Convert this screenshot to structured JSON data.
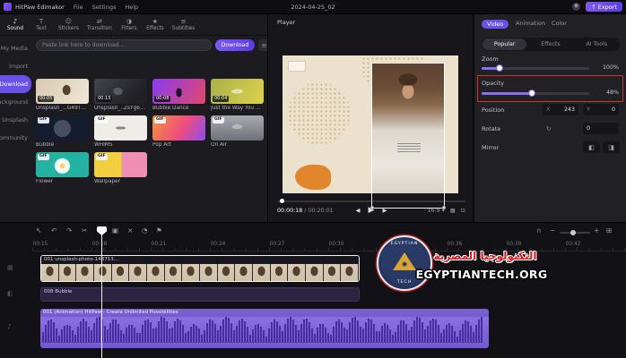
{
  "titlebar": {
    "app_name": "HitPaw Edimakor",
    "menus": [
      "File",
      "Settings",
      "Help"
    ],
    "project_name": "2024-04-25_02",
    "export_label": "Export"
  },
  "asset_tabs": [
    "Sound",
    "Text",
    "Stickers",
    "Transition",
    "Filters",
    "Effects",
    "Subtitles"
  ],
  "sidebar": {
    "items": [
      "My Media",
      "Import",
      "Download",
      "Background",
      "Unsplash",
      "Community"
    ]
  },
  "download_bar": {
    "placeholder": "Paste link here to download...",
    "button_label": "Download"
  },
  "media": {
    "items": [
      {
        "name": "Unsplash_...G49Tg6r",
        "duration": "00:05"
      },
      {
        "name": "Unsplash_..ZsYg6BU",
        "duration": "00:13"
      },
      {
        "name": "Bubble Dance",
        "duration": "00:08"
      },
      {
        "name": "Just the Way You Are",
        "duration": "00:04"
      },
      {
        "name": "Bubble",
        "badge": "GIF"
      },
      {
        "name": "WHIMS",
        "badge": "GIF"
      },
      {
        "name": "Pop Art",
        "badge": "GIF"
      },
      {
        "name": "On Air",
        "badge": "GIF"
      },
      {
        "name": "Flower",
        "badge": "GIF"
      },
      {
        "name": "Wallpaper",
        "badge": "GIF"
      }
    ]
  },
  "player": {
    "title": "Player",
    "current_time": "00:00:18",
    "total_time": " / 00:20:01",
    "ratio": "16:9"
  },
  "properties": {
    "tabs": [
      "Video",
      "Animation",
      "Color"
    ],
    "subtabs": [
      "Popular",
      "Effects",
      "AI Tools"
    ],
    "zoom_label": "Zoom",
    "zoom_value": "100%",
    "opacity_label": "Opacity",
    "opacity_value": "48%",
    "position_label": "Position",
    "x_label": "X",
    "x_value": "243",
    "y_label": "Y",
    "y_value": "0",
    "rotate_label": "Rotate",
    "rotate_value": "0",
    "mirror_label": "Mirror"
  },
  "timeline": {
    "ruler": [
      "00:15",
      "00:18",
      "00:21",
      "00:24",
      "00:27",
      "00:30",
      "00:33",
      "00:36",
      "00:39",
      "00:42"
    ],
    "clips": {
      "video_label": "001 unsplash-photo-148713...",
      "overlay_label": "008 Bubble",
      "audio_label": "001 (Animation) HitPaw - Create Unlimited Possibilities"
    }
  },
  "watermark": {
    "logo_line1": "EGYPTIAN",
    "logo_line2": "TECH",
    "arabic": "التكنولوجيا المصرية",
    "site": "EGYPTIANTECH.ORG"
  },
  "icons": {
    "sound": "♪",
    "text": "T",
    "stickers": "☺",
    "transition": "⇄",
    "filters": "◑",
    "effects": "★",
    "subtitles": "≡",
    "export": "↑",
    "list": "≡",
    "prev": "◀",
    "play": "▶",
    "next": "▶",
    "chevron": "▾",
    "grid": "▦",
    "fullscreen": "⊡",
    "cursor": "↖",
    "undo": "↶",
    "redo": "↷",
    "split": "✂",
    "crop": "▣",
    "delete": "×",
    "speed": "◔",
    "marker": "⚑",
    "magnet": "∩",
    "zoom_out": "−",
    "zoom_in": "+",
    "fit": "⊞",
    "rotate": "↻",
    "flip_h": "◧",
    "flip_v": "◨",
    "music": "♪",
    "eye": "◉"
  },
  "colors": {
    "accent": "#6a52e8",
    "annotation_red": "#d3352b",
    "audio_clip": "#7b5dd6"
  }
}
